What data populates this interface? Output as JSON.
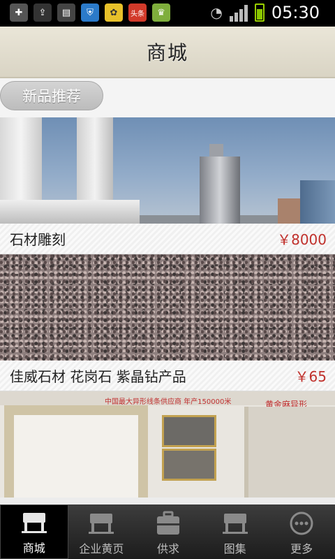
{
  "status_bar": {
    "time": "05:30",
    "notification_icons": [
      "add-icon",
      "upload-icon",
      "sd-card-icon",
      "shield-icon",
      "app-yellow-icon",
      "toutiao-icon",
      "android-market-icon"
    ],
    "toutiao_label": "头条"
  },
  "header": {
    "title": "商城"
  },
  "section": {
    "label": "新品推荐"
  },
  "products": [
    {
      "name": "石材雕刻",
      "price": "￥8000"
    },
    {
      "name": "佳威石材 花岗石 紫晶钻产品",
      "price": "￥65"
    },
    {
      "name": "",
      "price": ""
    }
  ],
  "image3_text": {
    "left": "中国最大异形线条供应商 年产150000米",
    "right": "黄金麻异形"
  },
  "tabs": [
    {
      "label": "商城",
      "icon": "store-icon",
      "active": true
    },
    {
      "label": "企业黄页",
      "icon": "store-icon",
      "active": false
    },
    {
      "label": "供求",
      "icon": "briefcase-icon",
      "active": false
    },
    {
      "label": "图集",
      "icon": "store-icon",
      "active": false
    },
    {
      "label": "更多",
      "icon": "more-icon",
      "active": false
    }
  ],
  "colors": {
    "price": "#c0302b",
    "tabbar": "#2a2a2a",
    "battery": "#8bc800"
  }
}
